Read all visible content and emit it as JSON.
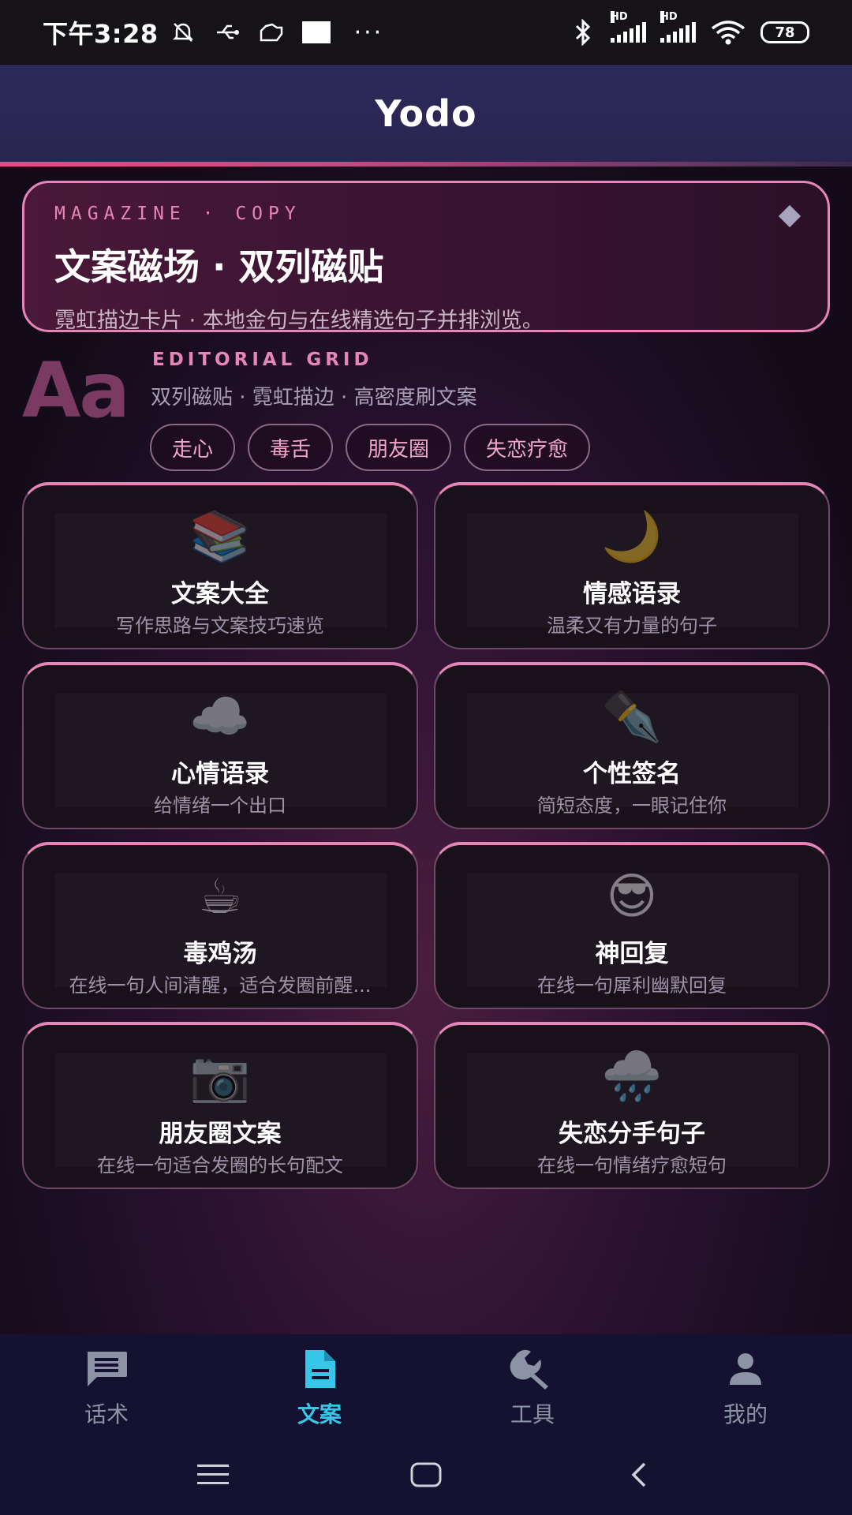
{
  "status_bar": {
    "time": "下午3:28",
    "battery": "78",
    "more_dots": "···"
  },
  "header": {
    "title": "Yodo"
  },
  "hero": {
    "kicker": "MAGAZINE · COPY",
    "headline": "文案磁场 · 双列磁贴",
    "subtitle": "霓虹描边卡片 · 本地金句与在线精选句子并排浏览。"
  },
  "editorial": {
    "aa": "Aa",
    "kicker": "EDITORIAL GRID",
    "description": "双列磁贴 · 霓虹描边 · 高密度刷文案",
    "tags": [
      "走心",
      "毒舌",
      "朋友圈",
      "失恋疗愈"
    ]
  },
  "cards": [
    {
      "icon": "books-icon",
      "emoji": "📚",
      "title": "文案大全",
      "subtitle": "写作思路与文案技巧速览"
    },
    {
      "icon": "crescent-moon-icon",
      "emoji": "🌙",
      "title": "情感语录",
      "subtitle": "温柔又有力量的句子"
    },
    {
      "icon": "cloud-icon",
      "emoji": "☁️",
      "title": "心情语录",
      "subtitle": "给情绪一个出口"
    },
    {
      "icon": "fountain-pen-icon",
      "emoji": "✒️",
      "title": "个性签名",
      "subtitle": "简短态度，一眼记住你"
    },
    {
      "icon": "hot-beverage-icon",
      "emoji": "☕",
      "title": "毒鸡汤",
      "subtitle": "在线一句人间清醒，适合发圈前醒..."
    },
    {
      "icon": "sunglasses-face-icon",
      "emoji": "😎",
      "title": "神回复",
      "subtitle": "在线一句犀利幽默回复"
    },
    {
      "icon": "camera-icon",
      "emoji": "📷",
      "title": "朋友圈文案",
      "subtitle": "在线一句适合发圈的长句配文"
    },
    {
      "icon": "rain-cloud-icon",
      "emoji": "🌧️",
      "title": "失恋分手句子",
      "subtitle": "在线一句情绪疗愈短句"
    }
  ],
  "bottom_nav": [
    {
      "label": "话术",
      "icon": "chat-icon",
      "active": false
    },
    {
      "label": "文案",
      "icon": "document-icon",
      "active": true
    },
    {
      "label": "工具",
      "icon": "wrench-icon",
      "active": false
    },
    {
      "label": "我的",
      "icon": "person-icon",
      "active": false
    }
  ],
  "colors": {
    "accent_pink": "#e585b8",
    "active_nav": "#36c6e8",
    "inactive_nav": "#8c93a4",
    "header_bg": "#2d2a5a"
  }
}
